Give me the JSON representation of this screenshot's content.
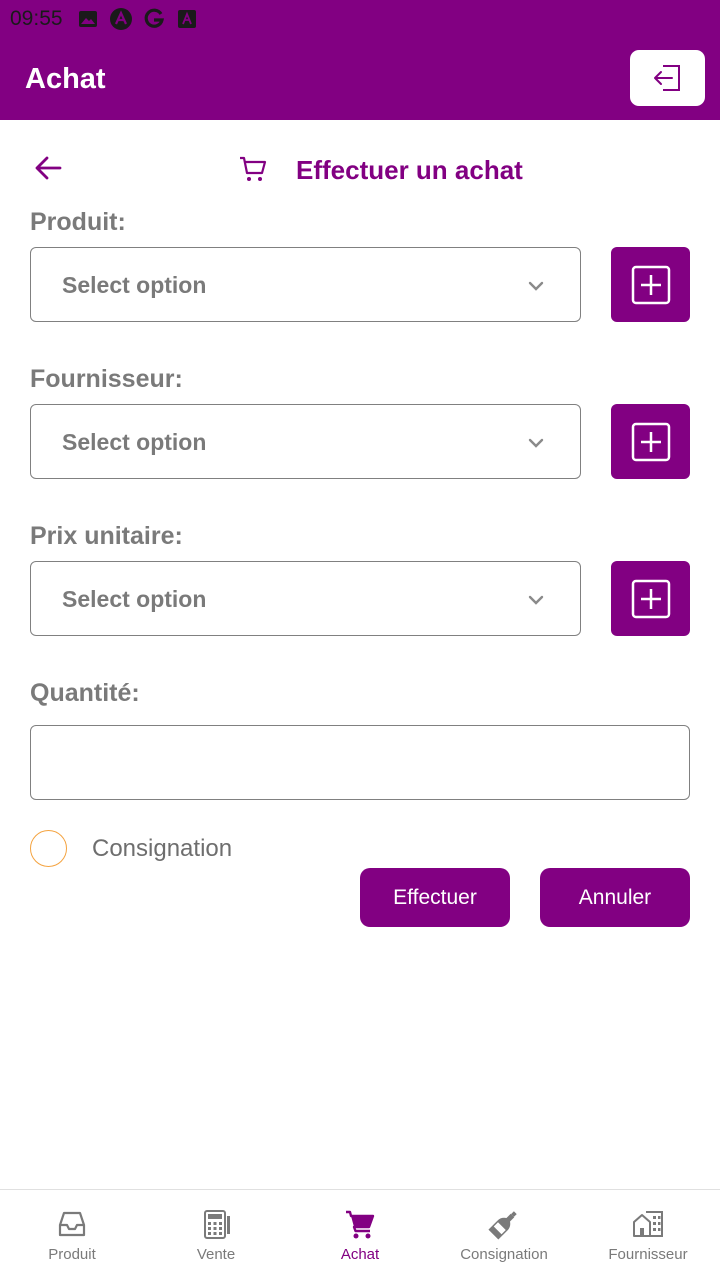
{
  "status_bar": {
    "time": "09:55",
    "icons": [
      "image-icon",
      "a-badge-icon",
      "google-icon",
      "a-square-icon"
    ]
  },
  "app_bar": {
    "title": "Achat",
    "logout_icon": "logout-icon"
  },
  "form": {
    "title": "Effectuer un achat",
    "back_icon": "arrow-left-icon",
    "title_icon": "cart-icon",
    "fields": [
      {
        "label": "Produit:",
        "placeholder": "Select option"
      },
      {
        "label": "Fournisseur:",
        "placeholder": "Select option"
      },
      {
        "label": "Prix unitaire:",
        "placeholder": "Select option"
      }
    ],
    "quantity": {
      "label": "Quantité:",
      "value": ""
    },
    "consignation": {
      "label": "Consignation",
      "checked": false
    },
    "submit_label": "Effectuer",
    "cancel_label": "Annuler"
  },
  "bottom_nav": {
    "items": [
      {
        "label": "Produit",
        "icon": "inbox-icon"
      },
      {
        "label": "Vente",
        "icon": "calculator-icon"
      },
      {
        "label": "Achat",
        "icon": "shopping-cart-icon",
        "active": true
      },
      {
        "label": "Consignation",
        "icon": "bottle-icon"
      },
      {
        "label": "Fournisseur",
        "icon": "building-icon"
      }
    ]
  },
  "colors": {
    "primary": "#820082",
    "radio_border": "#f4a340",
    "label_gray": "#7a7a7a"
  }
}
